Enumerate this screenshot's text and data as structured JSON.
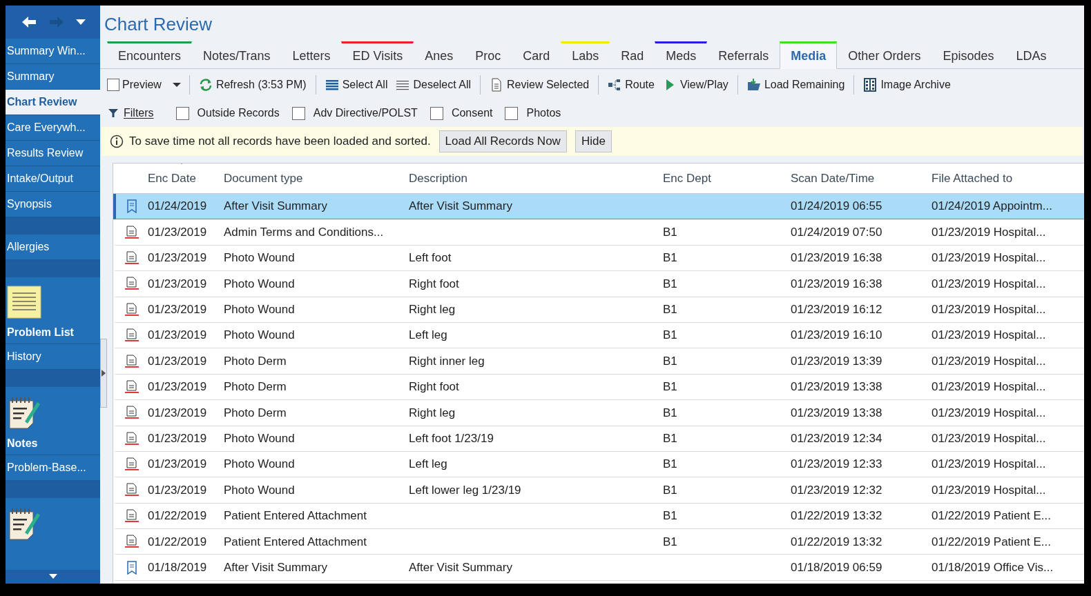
{
  "sidebar": {
    "items": [
      {
        "kind": "item",
        "label": "Summary Win...",
        "selected": false
      },
      {
        "kind": "item",
        "label": "Summary",
        "selected": false
      },
      {
        "kind": "item",
        "label": "Chart Review",
        "selected": true
      },
      {
        "kind": "item",
        "label": "Care Everywh...",
        "selected": false
      },
      {
        "kind": "item",
        "label": "Results Review",
        "selected": false
      },
      {
        "kind": "item",
        "label": "Intake/Output",
        "selected": false
      },
      {
        "kind": "item",
        "label": "Synopsis",
        "selected": false
      },
      {
        "kind": "spacer"
      },
      {
        "kind": "item",
        "label": "Allergies",
        "selected": false
      },
      {
        "kind": "spacer"
      },
      {
        "kind": "note",
        "label": "Problem List",
        "selected": false
      },
      {
        "kind": "item",
        "label": "History",
        "selected": false
      },
      {
        "kind": "spacer"
      },
      {
        "kind": "pad",
        "label": "Notes",
        "selected": false
      },
      {
        "kind": "item",
        "label": "Problem-Base...",
        "selected": false
      },
      {
        "kind": "spacer"
      },
      {
        "kind": "orders"
      }
    ]
  },
  "title": "Chart Review",
  "tabs": [
    {
      "label": "Encounters",
      "selected": false,
      "color": "#1f9e4a"
    },
    {
      "label": "Notes/Trans",
      "selected": false
    },
    {
      "label": "Letters",
      "selected": false
    },
    {
      "label": "ED Visits",
      "selected": false,
      "color": "#e8202e"
    },
    {
      "label": "Anes",
      "selected": false
    },
    {
      "label": "Proc",
      "selected": false
    },
    {
      "label": "Card",
      "selected": false
    },
    {
      "label": "Labs",
      "selected": false,
      "color": "#f2ea00"
    },
    {
      "label": "Rad",
      "selected": false
    },
    {
      "label": "Meds",
      "selected": false,
      "color": "#2a1de0"
    },
    {
      "label": "Referrals",
      "selected": false
    },
    {
      "label": "Media",
      "selected": true,
      "color": "#3ee020"
    },
    {
      "label": "Other Orders",
      "selected": false
    },
    {
      "label": "Episodes",
      "selected": false
    },
    {
      "label": "LDAs",
      "selected": false
    }
  ],
  "toolbar": [
    {
      "kind": "preview",
      "label": "Preview",
      "checked": false
    },
    {
      "kind": "refresh",
      "label": "Refresh (3:53 PM)"
    },
    {
      "kind": "select-all",
      "label": "Select All"
    },
    {
      "kind": "deselect-all",
      "label": "Deselect All"
    },
    {
      "kind": "review",
      "label": "Review Selected"
    },
    {
      "kind": "route",
      "label": "Route"
    },
    {
      "kind": "play",
      "label": "View/Play"
    },
    {
      "kind": "load",
      "label": "Load Remaining"
    },
    {
      "kind": "archive",
      "label": "Image Archive"
    }
  ],
  "filters": {
    "label": "Filters",
    "checkboxes": [
      {
        "label": "Outside Records",
        "checked": false
      },
      {
        "label": "Adv Directive/POLST",
        "checked": false
      },
      {
        "label": "Consent",
        "checked": false
      },
      {
        "label": "Photos",
        "checked": false
      }
    ]
  },
  "notice": {
    "text": "To save time not all records have been loaded and sorted.",
    "buttons": [
      "Load All Records Now",
      "Hide"
    ]
  },
  "table": {
    "columns": [
      "Enc Date",
      "Document type",
      "Description",
      "Enc Dept",
      "Scan Date/Time",
      "File Attached to"
    ],
    "rows": [
      {
        "kind": "avs",
        "selected": true,
        "cells": [
          "01/24/2019",
          "After Visit Summary",
          "After Visit Summary",
          "",
          "01/24/2019 06:55",
          "01/24/2019 Appointm..."
        ]
      },
      {
        "kind": "doc",
        "selected": false,
        "cells": [
          "01/23/2019",
          "Admin Terms and Conditions...",
          "",
          "B1",
          "01/24/2019 07:50",
          "01/23/2019 Hospital..."
        ]
      },
      {
        "kind": "doc",
        "selected": false,
        "cells": [
          "01/23/2019",
          "Photo Wound",
          "Left foot",
          "B1",
          "01/23/2019 16:38",
          "01/23/2019 Hospital..."
        ]
      },
      {
        "kind": "doc",
        "selected": false,
        "cells": [
          "01/23/2019",
          "Photo Wound",
          "Right foot",
          "B1",
          "01/23/2019 16:38",
          "01/23/2019 Hospital..."
        ]
      },
      {
        "kind": "doc",
        "selected": false,
        "cells": [
          "01/23/2019",
          "Photo Wound",
          "Right leg",
          "B1",
          "01/23/2019 16:12",
          "01/23/2019 Hospital..."
        ]
      },
      {
        "kind": "doc",
        "selected": false,
        "cells": [
          "01/23/2019",
          "Photo Wound",
          "Left leg",
          "B1",
          "01/23/2019 16:10",
          "01/23/2019 Hospital..."
        ]
      },
      {
        "kind": "doc",
        "selected": false,
        "cells": [
          "01/23/2019",
          "Photo Derm",
          "Right inner leg",
          "B1",
          "01/23/2019 13:39",
          "01/23/2019 Hospital..."
        ]
      },
      {
        "kind": "doc",
        "selected": false,
        "cells": [
          "01/23/2019",
          "Photo Derm",
          "Right foot",
          "B1",
          "01/23/2019 13:38",
          "01/23/2019 Hospital..."
        ]
      },
      {
        "kind": "doc",
        "selected": false,
        "cells": [
          "01/23/2019",
          "Photo Derm",
          "Right leg",
          "B1",
          "01/23/2019 13:38",
          "01/23/2019 Hospital..."
        ]
      },
      {
        "kind": "doc",
        "selected": false,
        "cells": [
          "01/23/2019",
          "Photo Wound",
          "Left foot 1/23/19",
          "B1",
          "01/23/2019 12:34",
          "01/23/2019 Hospital..."
        ]
      },
      {
        "kind": "doc",
        "selected": false,
        "cells": [
          "01/23/2019",
          "Photo Wound",
          "Left leg",
          "B1",
          "01/23/2019 12:33",
          "01/23/2019 Hospital..."
        ]
      },
      {
        "kind": "doc",
        "selected": false,
        "cells": [
          "01/23/2019",
          "Photo Wound",
          "Left lower leg 1/23/19",
          "B1",
          "01/23/2019 12:32",
          "01/23/2019 Hospital..."
        ]
      },
      {
        "kind": "doc",
        "selected": false,
        "cells": [
          "01/22/2019",
          "Patient Entered Attachment",
          "",
          "B1",
          "01/22/2019 13:32",
          "01/22/2019 Patient E..."
        ]
      },
      {
        "kind": "doc",
        "selected": false,
        "cells": [
          "01/22/2019",
          "Patient Entered Attachment",
          "",
          "B1",
          "01/22/2019 13:32",
          "01/22/2019 Patient E..."
        ]
      },
      {
        "kind": "avs",
        "selected": false,
        "cells": [
          "01/18/2019",
          "After Visit Summary",
          "After Visit Summary",
          "",
          "01/18/2019 06:59",
          "01/18/2019 Office Vis..."
        ]
      }
    ]
  }
}
